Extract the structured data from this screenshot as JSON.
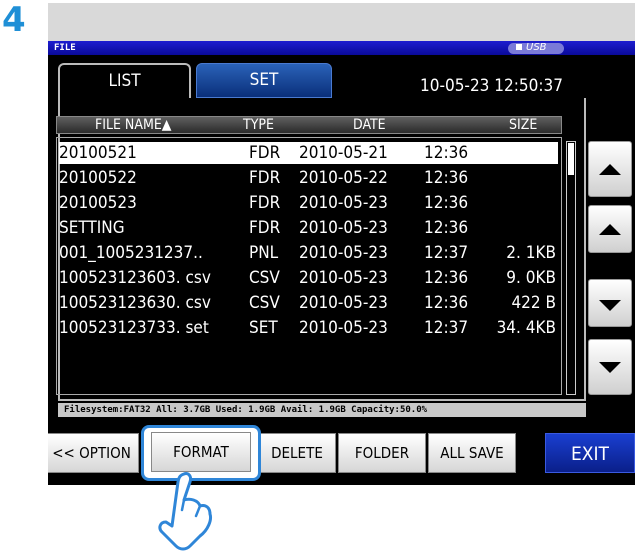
{
  "step_number": "4",
  "window": {
    "title": "FILE",
    "usb_label": "USB"
  },
  "tabs": [
    {
      "label": "LIST",
      "active": true
    },
    {
      "label": "SET",
      "active": false
    }
  ],
  "datetime": "10-05-23 12:50:37",
  "columns": {
    "name": "FILE NAME▲",
    "type": "TYPE",
    "date": "DATE",
    "size": "SIZE"
  },
  "files": [
    {
      "name": "20100521",
      "type": "FDR",
      "date": "2010-05-21",
      "time": "12:36",
      "size": "",
      "selected": true
    },
    {
      "name": "20100522",
      "type": "FDR",
      "date": "2010-05-22",
      "time": "12:36",
      "size": ""
    },
    {
      "name": "20100523",
      "type": "FDR",
      "date": "2010-05-23",
      "time": "12:36",
      "size": ""
    },
    {
      "name": "SETTING",
      "type": "FDR",
      "date": "2010-05-23",
      "time": "12:36",
      "size": ""
    },
    {
      "name": "001_1005231237..",
      "type": "PNL",
      "date": "2010-05-23",
      "time": "12:37",
      "size": "2. 1KB"
    },
    {
      "name": "100523123603. csv",
      "type": "CSV",
      "date": "2010-05-23",
      "time": "12:36",
      "size": "9. 0KB"
    },
    {
      "name": "100523123630. csv",
      "type": "CSV",
      "date": "2010-05-23",
      "time": "12:36",
      "size": "422 B"
    },
    {
      "name": "100523123733. set",
      "type": "SET",
      "date": "2010-05-23",
      "time": "12:37",
      "size": "34. 4KB"
    }
  ],
  "status": "Filesystem:FAT32 All: 3.7GB Used: 1.9GB Avail: 1.9GB Capacity:50.0%",
  "buttons": {
    "options": "<< OPTION",
    "format": "FORMAT",
    "delete": "DELETE",
    "folder": "FOLDER",
    "all_save": "ALL SAVE",
    "exit": "EXIT"
  },
  "colors": {
    "step_number": "#1f8fd6",
    "highlight": "#2f86d8",
    "title_bar": "#0a0a9a"
  }
}
